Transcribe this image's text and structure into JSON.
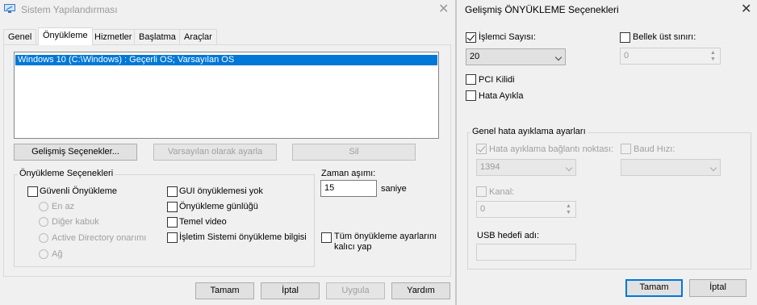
{
  "left_window": {
    "title": "Sistem Yapılandırması",
    "tabs": [
      "Genel",
      "Önyükleme",
      "Hizmetler",
      "Başlatma",
      "Araçlar"
    ],
    "active_tab": "Önyükleme",
    "boot_entries": [
      "Windows 10 (C:\\Windows) : Geçerli OS; Varsayılan OS"
    ],
    "buttons": {
      "advanced": "Gelişmiş Seçenekler...",
      "set_default": "Varsayılan olarak ayarla",
      "delete": "Sil"
    },
    "boot_options": {
      "group_label": "Önyükleme Seçenekleri",
      "safe_boot": "Güvenli Önyükleme",
      "radios": [
        "En az",
        "Diğer kabuk",
        "Active Directory onarımı",
        "Ağ"
      ],
      "no_gui": "GUI önyüklemesi yok",
      "boot_log": "Önyükleme günlüğü",
      "base_video": "Temel video",
      "os_boot_info": "İşletim Sistemi önyükleme bilgisi"
    },
    "timeout": {
      "label": "Zaman aşımı:",
      "value": "15",
      "unit": "saniye"
    },
    "permanent": "Tüm önyükleme ayarlarını kalıcı yap",
    "footer": {
      "ok": "Tamam",
      "cancel": "İptal",
      "apply": "Uygula",
      "help": "Yardım"
    }
  },
  "right_window": {
    "title": "Gelişmiş ÖNYÜKLEME Seçenekleri",
    "cpu_count_label": "İşlemci Sayısı:",
    "cpu_count_value": "20",
    "max_memory_label": "Bellek üst sınırı:",
    "max_memory_value": "0",
    "pci_lock": "PCI Kilidi",
    "debug": "Hata Ayıkla",
    "debug_settings": {
      "group_label": "Genel hata ayıklama ayarları",
      "port_label": "Hata ayıklama bağlantı noktası:",
      "port_value": "1394",
      "baud_label": "Baud Hızı:",
      "channel_label": "Kanal:",
      "channel_value": "0",
      "usb_label": "USB hedefi adı:"
    },
    "ok": "Tamam",
    "cancel": "İptal"
  },
  "colors": {
    "accent": "#0078d7",
    "window_bg": "#f0f0f0",
    "disabled_text": "#a0a0a0"
  }
}
